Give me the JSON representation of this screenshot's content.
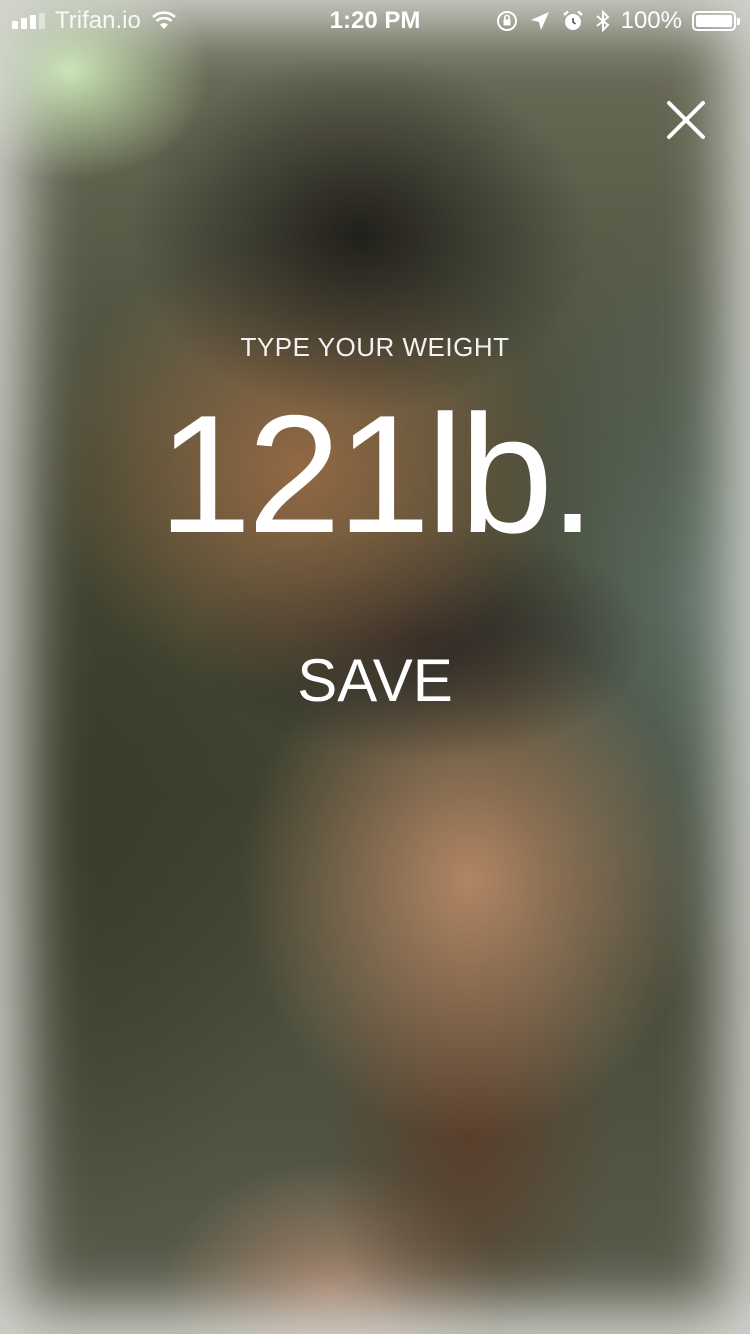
{
  "status_bar": {
    "carrier": "Trifan.io",
    "time": "1:20 PM",
    "battery": "100%",
    "icons": [
      "signal-icon",
      "wifi-icon",
      "orientation-lock-icon",
      "location-icon",
      "alarm-icon",
      "bluetooth-icon",
      "battery-icon"
    ]
  },
  "dialog": {
    "close_icon": "close-icon",
    "prompt": "TYPE YOUR WEIGHT",
    "weight_value": "121lb.",
    "save_label": "SAVE"
  },
  "colors": {
    "text": "#ffffff"
  }
}
